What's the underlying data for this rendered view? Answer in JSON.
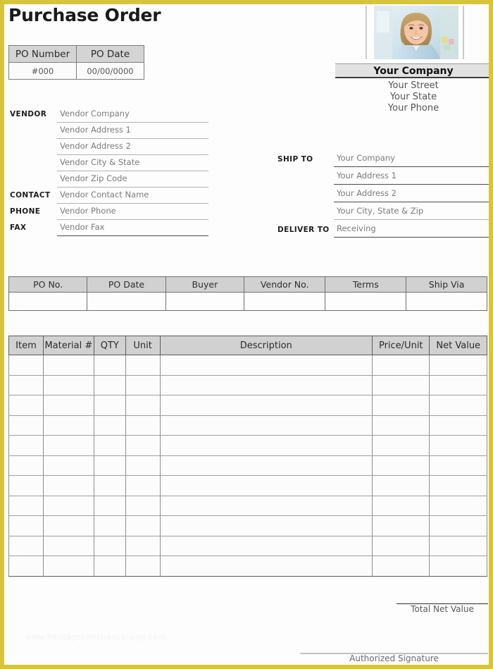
{
  "document": {
    "title": "Purchase Order",
    "watermark": "www.heritagechristiancollege.com",
    "border_color": "#d6c53a",
    "header_fill": "#d1d1d1"
  },
  "po_summary": {
    "headers": [
      "PO Number",
      "PO Date"
    ],
    "values": [
      "#000",
      "00/00/0000"
    ]
  },
  "company": {
    "logo_alt": "smiling-woman-photo",
    "name": "Your Company",
    "lines": [
      "Your Street",
      "Your State",
      "Your Phone"
    ]
  },
  "vendor": {
    "rows": [
      {
        "label": "VENDOR",
        "value": "Vendor Company"
      },
      {
        "label": "",
        "value": "Vendor Address 1"
      },
      {
        "label": "",
        "value": "Vendor Address 2"
      },
      {
        "label": "",
        "value": "Vendor City & State"
      },
      {
        "label": "",
        "value": "Vendor Zip Code"
      },
      {
        "label": "CONTACT",
        "value": "Vendor Contact Name"
      },
      {
        "label": "PHONE",
        "value": "Vendor Phone"
      },
      {
        "label": "FAX",
        "value": "Vendor Fax"
      }
    ]
  },
  "ship_to": {
    "rows": [
      {
        "label": "SHIP TO",
        "value": "Your Company"
      },
      {
        "label": "",
        "value": "Your Address 1"
      },
      {
        "label": "",
        "value": "Your Address 2"
      },
      {
        "label": "",
        "value": "Your City, State & Zip"
      },
      {
        "label": "DELIVER TO",
        "value": "Receiving"
      }
    ]
  },
  "po_detail": {
    "headers": [
      "PO No.",
      "PO Date",
      "Buyer",
      "Vendor No.",
      "Terms",
      "Ship Via"
    ],
    "rows": [
      [
        "",
        "",
        "",
        "",
        "",
        ""
      ]
    ]
  },
  "items_table": {
    "headers": [
      "Item",
      "Material #",
      "QTY",
      "Unit",
      "Description",
      "Price/Unit",
      "Net Value"
    ],
    "row_count": 11,
    "rows": [
      [
        "",
        "",
        "",
        "",
        "",
        "",
        ""
      ],
      [
        "",
        "",
        "",
        "",
        "",
        "",
        ""
      ],
      [
        "",
        "",
        "",
        "",
        "",
        "",
        ""
      ],
      [
        "",
        "",
        "",
        "",
        "",
        "",
        ""
      ],
      [
        "",
        "",
        "",
        "",
        "",
        "",
        ""
      ],
      [
        "",
        "",
        "",
        "",
        "",
        "",
        ""
      ],
      [
        "",
        "",
        "",
        "",
        "",
        "",
        ""
      ],
      [
        "",
        "",
        "",
        "",
        "",
        "",
        ""
      ],
      [
        "",
        "",
        "",
        "",
        "",
        "",
        ""
      ],
      [
        "",
        "",
        "",
        "",
        "",
        "",
        ""
      ],
      [
        "",
        "",
        "",
        "",
        "",
        "",
        ""
      ]
    ]
  },
  "footer": {
    "total_label": "Total Net Value",
    "total_value": "",
    "signature_label": "Authorized Signature"
  }
}
